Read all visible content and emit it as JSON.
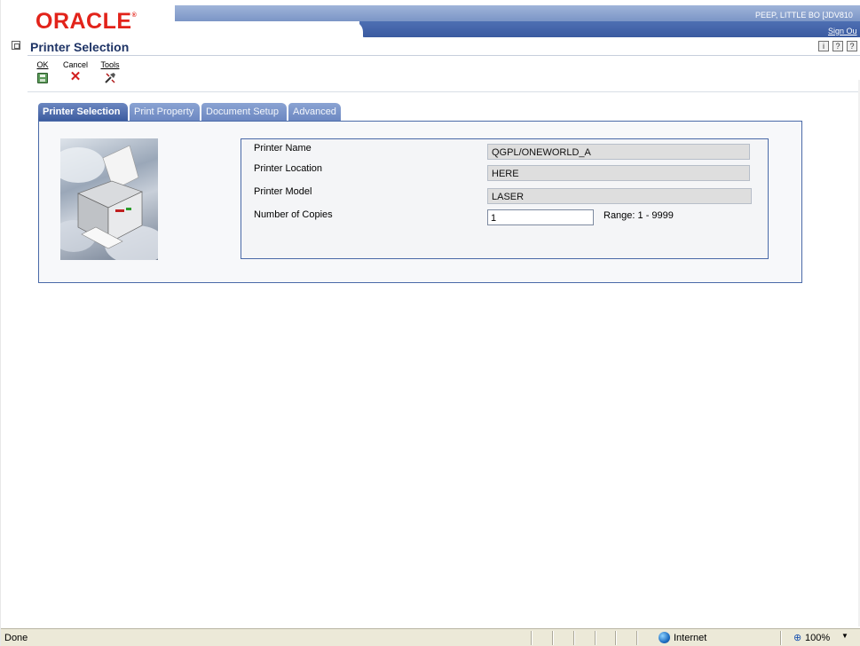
{
  "header": {
    "logo": "ORACLE",
    "user": "PEEP, LITTLE BO  [JDV810",
    "sign_out": "Sign Ou"
  },
  "page": {
    "title": "Printer Selection",
    "icons": [
      "info-icon",
      "help-icon",
      "context-help-icon"
    ]
  },
  "toolbar": {
    "ok_label": "OK",
    "cancel_label": "Cancel",
    "tools_label": "Tools"
  },
  "tabs": [
    {
      "label": "Printer Selection",
      "active": true
    },
    {
      "label": "Print Property",
      "active": false
    },
    {
      "label": "Document Setup",
      "active": false
    },
    {
      "label": "Advanced",
      "active": false
    }
  ],
  "form": {
    "printer_name_label": "Printer Name",
    "printer_name_value": "QGPL/ONEWORLD_A",
    "printer_location_label": "Printer Location",
    "printer_location_value": "HERE",
    "printer_model_label": "Printer Model",
    "printer_model_value": "LASER",
    "copies_label": "Number of Copies",
    "copies_value": "1",
    "range_label": "Range: 1 - 9999"
  },
  "statusbar": {
    "status": "Done",
    "zone": "Internet",
    "zoom": "100%"
  },
  "colors": {
    "brand_red": "#e2231a",
    "title_blue": "#1f3466",
    "tab_active": "#3a5a9e",
    "panel_border": "#4a6aa8"
  }
}
